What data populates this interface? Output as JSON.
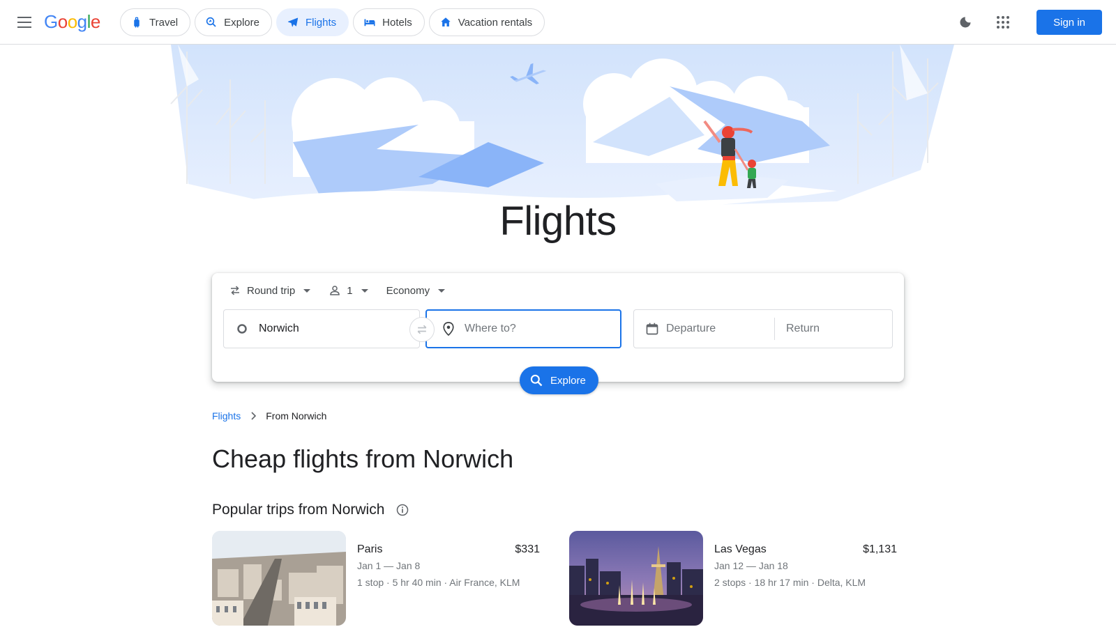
{
  "header": {
    "logo": "Google",
    "nav": [
      {
        "label": "Travel",
        "icon": "suitcase-icon"
      },
      {
        "label": "Explore",
        "icon": "explore-icon"
      },
      {
        "label": "Flights",
        "icon": "airplane-icon",
        "active": true
      },
      {
        "label": "Hotels",
        "icon": "bed-icon"
      },
      {
        "label": "Vacation rentals",
        "icon": "house-icon"
      }
    ],
    "sign_in": "Sign in"
  },
  "hero": {
    "title": "Flights"
  },
  "search": {
    "trip_type": "Round trip",
    "passengers": "1",
    "cabin": "Economy",
    "from_value": "Norwich",
    "to_placeholder": "Where to?",
    "departure_placeholder": "Departure",
    "return_placeholder": "Return",
    "explore_label": "Explore"
  },
  "breadcrumb": {
    "root": "Flights",
    "current": "From Norwich"
  },
  "page_heading": "Cheap flights from Norwich",
  "popular": {
    "heading": "Popular trips from Norwich",
    "trips": [
      {
        "city": "Paris",
        "price": "$331",
        "dates": "Jan 1 — Jan 8",
        "info": "1 stop · 5 hr 40 min · Air France, KLM"
      },
      {
        "city": "Las Vegas",
        "price": "$1,131",
        "dates": "Jan 12 — Jan 18",
        "info": "2 stops · 18 hr 17 min · Delta, KLM"
      }
    ]
  },
  "colors": {
    "accent": "#1a73e8",
    "active_chip_bg": "#e8f0fe"
  }
}
